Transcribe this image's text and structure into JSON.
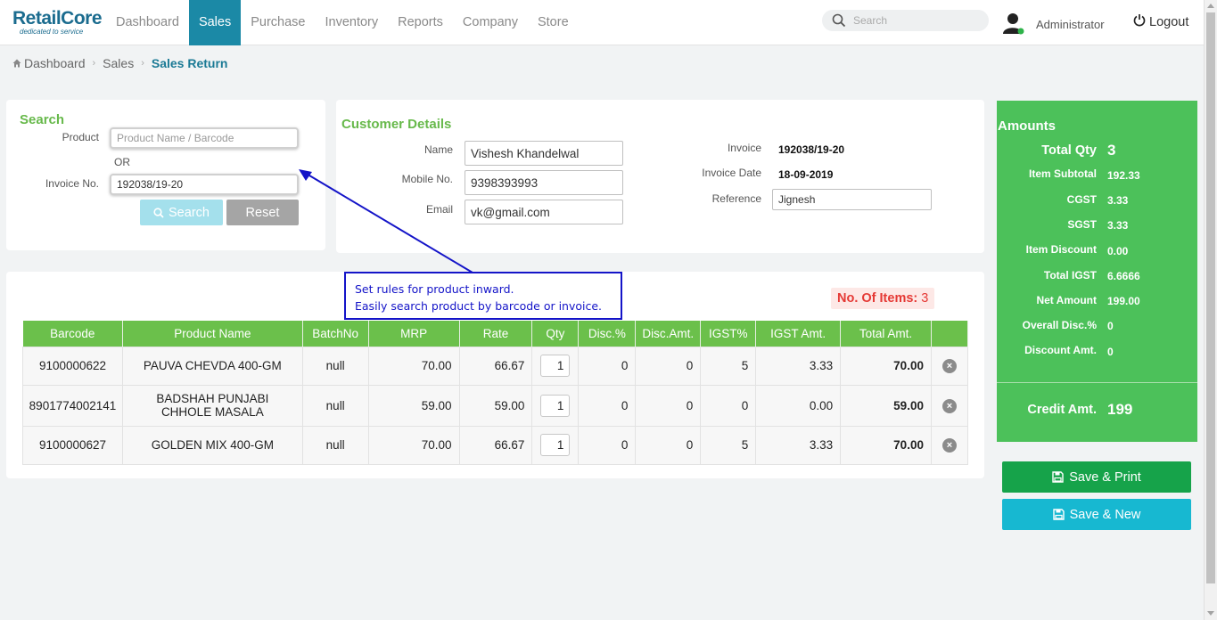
{
  "app": {
    "brand": "RetailCore",
    "tagline": "dedicated to service"
  },
  "nav": [
    {
      "label": "Dashboard",
      "active": false
    },
    {
      "label": "Sales",
      "active": true
    },
    {
      "label": "Purchase",
      "active": false
    },
    {
      "label": "Inventory",
      "active": false
    },
    {
      "label": "Reports",
      "active": false
    },
    {
      "label": "Company",
      "active": false
    },
    {
      "label": "Store",
      "active": false
    }
  ],
  "header": {
    "search_placeholder": "Search",
    "user_name": "Administrator",
    "logout_label": "Logout"
  },
  "breadcrumb": {
    "home": "Dashboard",
    "section": "Sales",
    "current": "Sales Return"
  },
  "search_panel": {
    "title": "Search",
    "product_label": "Product",
    "product_placeholder": "Product Name / Barcode",
    "or_text": "OR",
    "invoice_label": "Invoice No.",
    "invoice_value": "192038/19-20",
    "search_button": "Search",
    "reset_button": "Reset"
  },
  "customer": {
    "title": "Customer Details",
    "name_label": "Name",
    "name_value": "Vishesh Khandelwal",
    "mobile_label": "Mobile No.",
    "mobile_value": "9398393993",
    "email_label": "Email",
    "email_value": "vk@gmail.com",
    "invoice_label": "Invoice",
    "invoice_value": "192038/19-20",
    "invoice_date_label": "Invoice Date",
    "invoice_date_value": "18-09-2019",
    "reference_label": "Reference",
    "reference_value": "Jignesh"
  },
  "tooltip": {
    "line1": "Set rules for product inward.",
    "line2": "Easily search product by barcode or invoice."
  },
  "items": {
    "count_label": "No. Of Items:",
    "count_value": "3",
    "columns": [
      "Barcode",
      "Product Name",
      "BatchNo",
      "MRP",
      "Rate",
      "Qty",
      "Disc.%",
      "Disc.Amt.",
      "IGST%",
      "IGST Amt.",
      "Total Amt.",
      ""
    ],
    "rows": [
      {
        "barcode": "9100000622",
        "name": "PAUVA CHEVDA 400-GM",
        "batch": "null",
        "mrp": "70.00",
        "rate": "66.67",
        "qty": "1",
        "disc_pct": "0",
        "disc_amt": "0",
        "igst_pct": "5",
        "igst_amt": "3.33",
        "total": "70.00"
      },
      {
        "barcode": "8901774002141",
        "name": "BADSHAH PUNJABI CHHOLE MASALA",
        "batch": "null",
        "mrp": "59.00",
        "rate": "59.00",
        "qty": "1",
        "disc_pct": "0",
        "disc_amt": "0",
        "igst_pct": "0",
        "igst_amt": "0.00",
        "total": "59.00"
      },
      {
        "barcode": "9100000627",
        "name": "GOLDEN MIX 400-GM",
        "batch": "null",
        "mrp": "70.00",
        "rate": "66.67",
        "qty": "1",
        "disc_pct": "0",
        "disc_amt": "0",
        "igst_pct": "5",
        "igst_amt": "3.33",
        "total": "70.00"
      }
    ]
  },
  "amounts": {
    "title": "Amounts",
    "total_qty_label": "Total Qty",
    "total_qty": "3",
    "lines": [
      {
        "label": "Item Subtotal",
        "value": "192.33"
      },
      {
        "label": "CGST",
        "value": "3.33"
      },
      {
        "label": "SGST",
        "value": "3.33"
      },
      {
        "label": "Item Discount",
        "value": "0.00"
      },
      {
        "label": "Total IGST",
        "value": "6.6666"
      },
      {
        "label": "Net Amount",
        "value": "199.00"
      },
      {
        "label": "Overall Disc.%",
        "value": "0"
      },
      {
        "label": "Discount Amt.",
        "value": "0"
      }
    ],
    "credit_label": "Credit Amt.",
    "credit_value": "199"
  },
  "actions": {
    "save_print": "Save & Print",
    "save_new": "Save & New"
  },
  "colors": {
    "nav_active": "#1b89a6",
    "green": "#67b94b",
    "amounts_bg": "#4cc15a",
    "save_print": "#16a34a",
    "save_new": "#17b8d1",
    "tooltip_blue": "#1414c8",
    "items_count": "#e53935"
  }
}
